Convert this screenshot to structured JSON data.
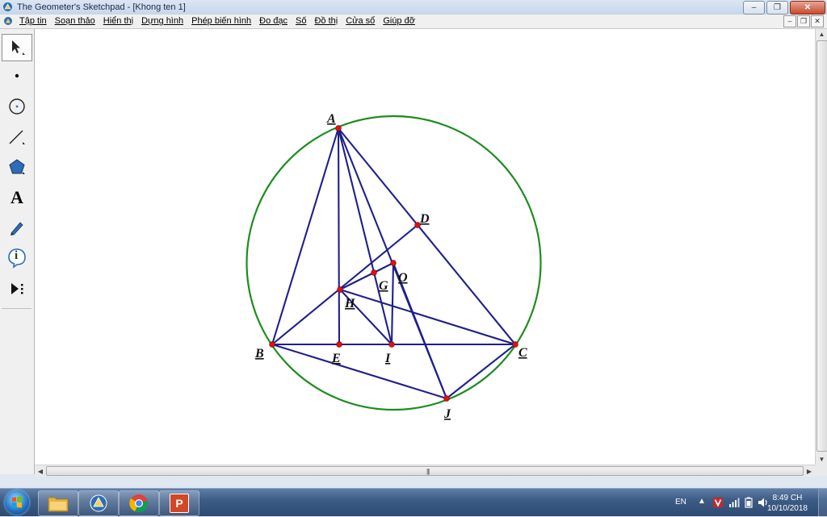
{
  "window": {
    "title": "The Geometer's Sketchpad - [Khong ten 1]",
    "controls": {
      "minimize": "–",
      "restore": "❐",
      "close": "✕"
    }
  },
  "menubar": {
    "items": [
      {
        "label": "Tập tin"
      },
      {
        "label": "Soạn thảo"
      },
      {
        "label": "Hiển thị"
      },
      {
        "label": "Dựng hình"
      },
      {
        "label": "Phép biến hình"
      },
      {
        "label": "Đo đạc"
      },
      {
        "label": "Số"
      },
      {
        "label": "Đồ thị"
      },
      {
        "label": "Cửa sổ"
      },
      {
        "label": "Giúp đỡ"
      }
    ],
    "doc_controls": {
      "minimize": "–",
      "restore": "❐",
      "close": "✕"
    }
  },
  "toolbox": {
    "tools": [
      {
        "name": "arrow-tool",
        "icon": "arrow-select-icon",
        "selected": true
      },
      {
        "name": "point-tool",
        "icon": "point-icon"
      },
      {
        "name": "compass-tool",
        "icon": "circle-icon"
      },
      {
        "name": "straightedge-tool",
        "icon": "line-icon"
      },
      {
        "name": "polygon-tool",
        "icon": "pentagon-icon"
      },
      {
        "name": "text-tool",
        "icon": "text-a-icon",
        "label": "A"
      },
      {
        "name": "marker-tool",
        "icon": "marker-pen-icon"
      },
      {
        "name": "information-tool",
        "icon": "info-icon",
        "label": "i"
      },
      {
        "name": "custom-tool",
        "icon": "custom-tools-icon"
      }
    ]
  },
  "sketch": {
    "circle_color": "#1e8c1e",
    "line_color": "#1f1f8c",
    "point_color": "#e01010",
    "point_labels": [
      "A",
      "B",
      "C",
      "D",
      "E",
      "G",
      "H",
      "I",
      "J",
      "O"
    ]
  },
  "taskbar": {
    "apps": [
      {
        "name": "file-explorer",
        "icon": "folder-icon"
      },
      {
        "name": "sketchpad",
        "icon": "sketchpad-icon"
      },
      {
        "name": "chrome",
        "icon": "chrome-icon"
      },
      {
        "name": "powerpoint",
        "icon": "powerpoint-icon",
        "label": "P"
      }
    ],
    "tray": {
      "language": "EN",
      "expand": "▲",
      "time": "8:49 CH",
      "date": "10/10/2018"
    }
  }
}
